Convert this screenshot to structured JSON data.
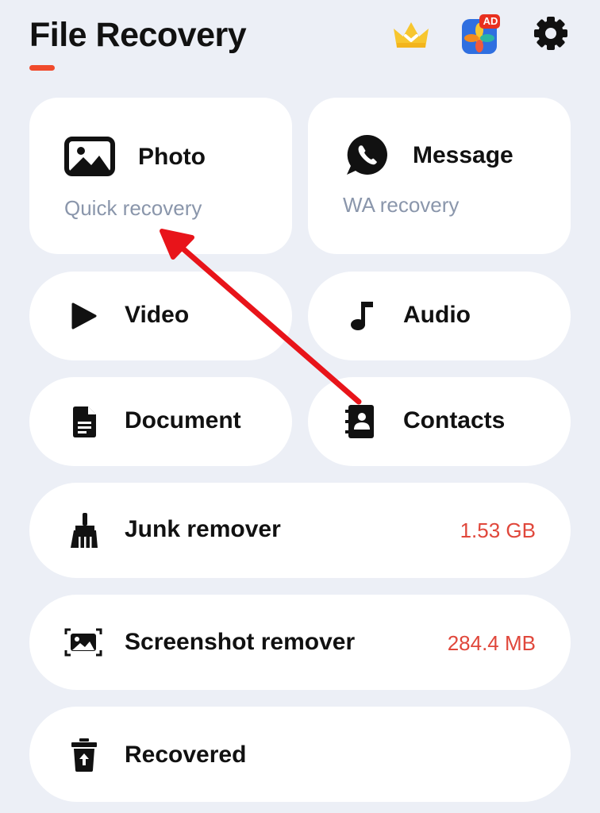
{
  "header": {
    "title": "File Recovery",
    "ad_badge": "AD",
    "icons": [
      "crown-icon",
      "photo-gallery-ad-icon",
      "gear-icon"
    ]
  },
  "cards": {
    "photo": {
      "title": "Photo",
      "subtitle": "Quick recovery",
      "icon": "image-icon"
    },
    "message": {
      "title": "Message",
      "subtitle": "WA recovery",
      "icon": "whatsapp-icon"
    },
    "video": {
      "title": "Video",
      "icon": "play-icon"
    },
    "audio": {
      "title": "Audio",
      "icon": "music-note-icon"
    },
    "document": {
      "title": "Document",
      "icon": "document-icon"
    },
    "contacts": {
      "title": "Contacts",
      "icon": "contacts-book-icon"
    }
  },
  "tools": {
    "junk": {
      "title": "Junk remover",
      "value": "1.53 GB",
      "icon": "broom-icon"
    },
    "screenshot": {
      "title": "Screenshot remover",
      "value": "284.4 MB",
      "icon": "screenshot-icon"
    },
    "recovered": {
      "title": "Recovered",
      "icon": "trash-restore-icon"
    }
  },
  "colors": {
    "background": "#eceff6",
    "card": "#ffffff",
    "accent": "#f04a2c",
    "value": "#e0473b",
    "subtitle": "#8a96ab",
    "crown": "#f7c62f",
    "annotation_arrow": "#e8141a"
  }
}
